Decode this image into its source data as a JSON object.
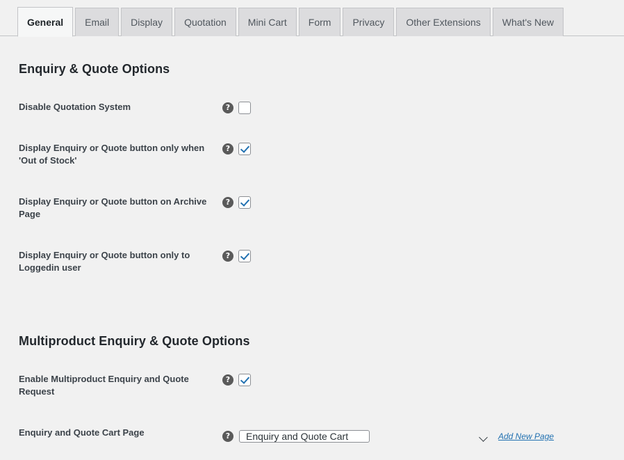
{
  "tabs": [
    {
      "label": "General",
      "active": true
    },
    {
      "label": "Email",
      "active": false
    },
    {
      "label": "Display",
      "active": false
    },
    {
      "label": "Quotation",
      "active": false
    },
    {
      "label": "Mini Cart",
      "active": false
    },
    {
      "label": "Form",
      "active": false
    },
    {
      "label": "Privacy",
      "active": false
    },
    {
      "label": "Other Extensions",
      "active": false
    },
    {
      "label": "What's New",
      "active": false
    }
  ],
  "sections": [
    {
      "heading": "Enquiry & Quote Options",
      "rows": [
        {
          "label": "Disable Quotation System",
          "help": "?",
          "checked": false
        },
        {
          "label": "Display Enquiry or Quote button only when 'Out of Stock'",
          "help": "?",
          "checked": true
        },
        {
          "label": "Display Enquiry or Quote button on Archive Page",
          "help": "?",
          "checked": true
        },
        {
          "label": "Display Enquiry or Quote button only to Loggedin user",
          "help": "?",
          "checked": true
        }
      ]
    },
    {
      "heading": "Multiproduct Enquiry & Quote Options",
      "rows": [
        {
          "label": "Enable Multiproduct Enquiry and Quote Request",
          "help": "?",
          "checked": true
        }
      ],
      "select_row": {
        "label": "Enquiry and Quote Cart Page",
        "help": "?",
        "value": "Enquiry and Quote Cart",
        "link_label": "Add New Page"
      }
    }
  ],
  "colors": {
    "accent": "#2271b1",
    "background": "#f1f1f1",
    "tab_inactive": "#dcdcde",
    "tab_active": "#f6f7f7",
    "border": "#c3c4c7",
    "text": "#3c434a",
    "heading": "#23282d"
  }
}
